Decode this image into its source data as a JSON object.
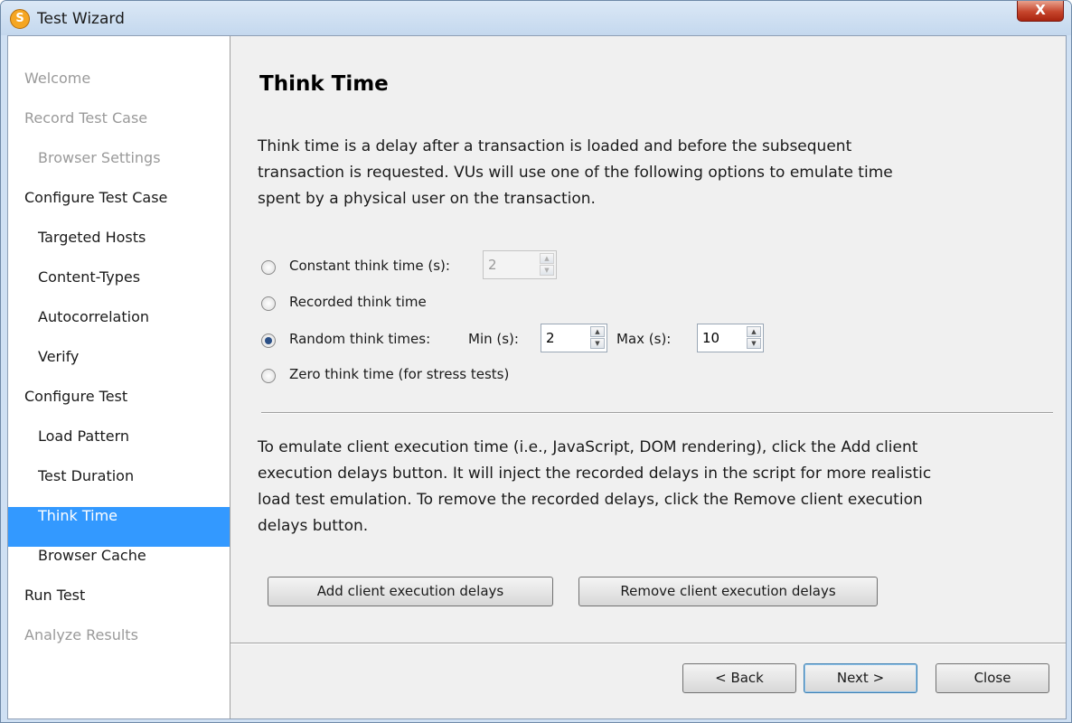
{
  "window": {
    "title": "Test Wizard",
    "icon_letter": "S",
    "close_glyph": "X"
  },
  "sidebar": {
    "items": [
      {
        "label": "Welcome",
        "level": 0,
        "state": "disabled"
      },
      {
        "label": "Record Test Case",
        "level": 0,
        "state": "disabled"
      },
      {
        "label": "Browser Settings",
        "level": 1,
        "state": "disabled"
      },
      {
        "label": "Configure Test Case",
        "level": 0,
        "state": "normal"
      },
      {
        "label": "Targeted Hosts",
        "level": 1,
        "state": "normal"
      },
      {
        "label": "Content-Types",
        "level": 1,
        "state": "normal"
      },
      {
        "label": "Autocorrelation",
        "level": 1,
        "state": "normal"
      },
      {
        "label": "Verify",
        "level": 1,
        "state": "normal"
      },
      {
        "label": "Configure Test",
        "level": 0,
        "state": "normal"
      },
      {
        "label": "Load Pattern",
        "level": 1,
        "state": "normal"
      },
      {
        "label": "Test Duration",
        "level": 1,
        "state": "normal"
      },
      {
        "label": "Think Time",
        "level": 1,
        "state": "selected"
      },
      {
        "label": "Browser Cache",
        "level": 1,
        "state": "normal"
      },
      {
        "label": "Run Test",
        "level": 0,
        "state": "normal"
      },
      {
        "label": "Analyze Results",
        "level": 0,
        "state": "disabled"
      }
    ]
  },
  "main": {
    "heading": "Think Time",
    "description": [
      "Think time is a delay after a transaction is loaded and before the subsequent",
      "transaction is requested. VUs will use one of the following options to emulate time",
      "spent by a physical user on the transaction."
    ],
    "options": {
      "selected": "random",
      "constant": {
        "label": "Constant think time (s):",
        "value": "2"
      },
      "recorded": {
        "label": "Recorded think time"
      },
      "random": {
        "label": "Random think times:",
        "min_label": "Min (s):",
        "min_value": "2",
        "max_label": "Max (s):",
        "max_value": "10"
      },
      "zero": {
        "label": "Zero think time (for stress tests)"
      }
    },
    "client_exec_text": [
      "To emulate client execution time (i.e., JavaScript, DOM rendering), click the Add client",
      "execution delays button. It will inject the recorded delays in the script for more realistic",
      "load test emulation. To remove the recorded delays, click the Remove client execution",
      "delays button."
    ],
    "add_delays_label": "Add client execution delays",
    "remove_delays_label": "Remove client execution delays"
  },
  "footer": {
    "back_label": "< Back",
    "next_label": "Next >",
    "close_label": "Close"
  },
  "colors": {
    "selection": "#3399ff",
    "window_frame": "#cfe0f3",
    "close_button": "#c6452c"
  }
}
